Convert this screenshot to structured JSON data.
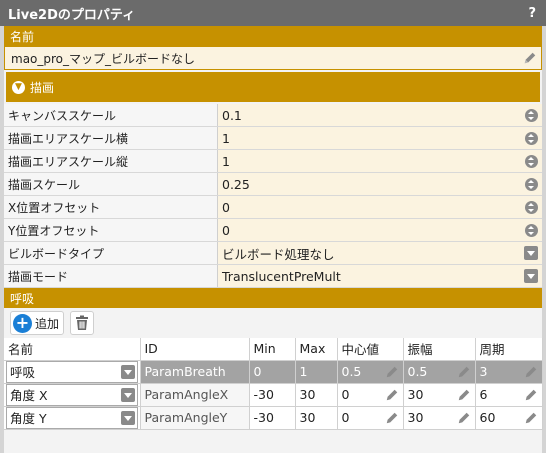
{
  "window": {
    "title": "Live2Dのプロパティ",
    "help": "?"
  },
  "name_section": {
    "label": "名前",
    "value": "mao_pro_マップ_ビルボードなし"
  },
  "draw_section": {
    "label": "描画",
    "rows": [
      {
        "label": "キャンバススケール",
        "value": "0.1",
        "control": "stepper"
      },
      {
        "label": "描画エリアスケール横",
        "value": "1",
        "control": "stepper"
      },
      {
        "label": "描画エリアスケール縦",
        "value": "1",
        "control": "stepper"
      },
      {
        "label": "描画スケール",
        "value": "0.25",
        "control": "stepper"
      },
      {
        "label": "X位置オフセット",
        "value": "0",
        "control": "stepper"
      },
      {
        "label": "Y位置オフセット",
        "value": "0",
        "control": "stepper"
      },
      {
        "label": "ビルボードタイプ",
        "value": "ビルボード処理なし",
        "control": "dropdown"
      },
      {
        "label": "描画モード",
        "value": "TranslucentPreMult",
        "control": "dropdown"
      }
    ]
  },
  "breath_section": {
    "label": "呼吸",
    "add_label": "追加",
    "columns": [
      "名前",
      "ID",
      "Min",
      "Max",
      "中心値",
      "振幅",
      "周期"
    ],
    "rows": [
      {
        "name": "呼吸",
        "id": "ParamBreath",
        "min": "0",
        "max": "1",
        "center": "0.5",
        "amplitude": "0.5",
        "period": "3",
        "selected": true
      },
      {
        "name": "角度 X",
        "id": "ParamAngleX",
        "min": "-30",
        "max": "30",
        "center": "0",
        "amplitude": "30",
        "period": "6",
        "selected": false
      },
      {
        "name": "角度 Y",
        "id": "ParamAngleY",
        "min": "-30",
        "max": "30",
        "center": "0",
        "amplitude": "30",
        "period": "60",
        "selected": false
      }
    ]
  },
  "colors": {
    "accent": "#c69100",
    "titlebar": "#6b6b6b",
    "add_icon": "#1a7fd6",
    "selected_row": "#a3a3a3"
  }
}
